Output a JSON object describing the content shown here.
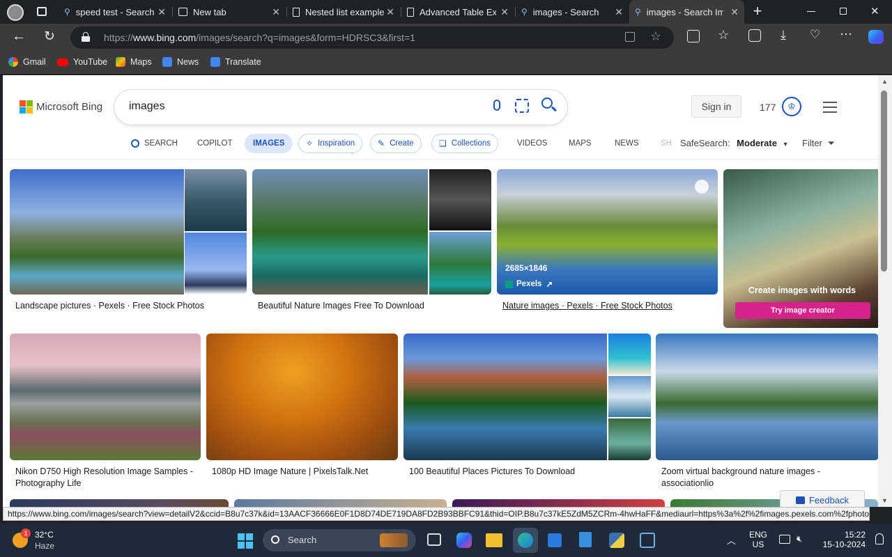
{
  "tabs": [
    {
      "title": "speed test - Search",
      "icon": "search-icon"
    },
    {
      "title": "New tab",
      "icon": "newtab-icon"
    },
    {
      "title": "Nested list example",
      "icon": "document-icon"
    },
    {
      "title": "Advanced Table Exa",
      "icon": "document-icon"
    },
    {
      "title": "images - Search",
      "icon": "search-icon"
    },
    {
      "title": "images - Search Im",
      "icon": "search-icon"
    }
  ],
  "address": {
    "prefix": "https://",
    "host": "www.bing.com",
    "path": "/images/search?q=images&form=HDRSC3&first=1"
  },
  "bookmarks": [
    {
      "label": "Gmail",
      "color": "#ea4335"
    },
    {
      "label": "YouTube",
      "color": "#ff0000"
    },
    {
      "label": "Maps",
      "color": "#34a853"
    },
    {
      "label": "News",
      "color": "#4285f4"
    },
    {
      "label": "Translate",
      "color": "#4285f4"
    }
  ],
  "bing": {
    "logo_text": "Microsoft Bing",
    "query": "images",
    "sign_in": "Sign in",
    "rewards": "177",
    "nav": {
      "search": "SEARCH",
      "copilot": "COPILOT",
      "images": "IMAGES",
      "inspiration": "Inspiration",
      "create": "Create",
      "collections": "Collections",
      "videos": "VIDEOS",
      "maps": "MAPS",
      "news": "NEWS",
      "shop": "SH"
    },
    "safesearch_label": "SafeSearch:",
    "safesearch_value": "Moderate",
    "filter_label": "Filter"
  },
  "results_row1": [
    {
      "caption": "Landscape pictures · Pexels · Free Stock Photos"
    },
    {
      "caption": "Beautiful Nature Images Free To Download"
    },
    {
      "caption": "Nature images · Pexels · Free Stock Photos",
      "dimensions": "2685×1846",
      "source": "Pexels"
    }
  ],
  "creator_card": {
    "title": "Create images with words",
    "button": "Try image creator"
  },
  "results_row2": [
    {
      "caption": "Nikon D750 High Resolution Image Samples - Photography Life"
    },
    {
      "caption": "1080p HD Image Nature | PixelsTalk.Net"
    },
    {
      "caption": "100 Beautiful Places Pictures To Download"
    },
    {
      "caption": "Zoom virtual background nature images - associationlio"
    }
  ],
  "feedback": "Feedback",
  "status_url": "https://www.bing.com/images/search?view=detailV2&ccid=B8u7c37k&id=13AACF36666E0F1D8D74DE719DA8FD2B93BBFC91&thid=OIP.B8u7c37kE5ZdM5ZCRm-4hwHaFF&mediaurl=https%3a%2f%2fimages.pexels.com%2fphotos...",
  "taskbar": {
    "weather_temp": "32°C",
    "weather_desc": "Haze",
    "weather_badge": "1",
    "search_label": "Search",
    "lang1": "ENG",
    "lang2": "US",
    "time": "15:22",
    "date": "15-10-2024"
  }
}
